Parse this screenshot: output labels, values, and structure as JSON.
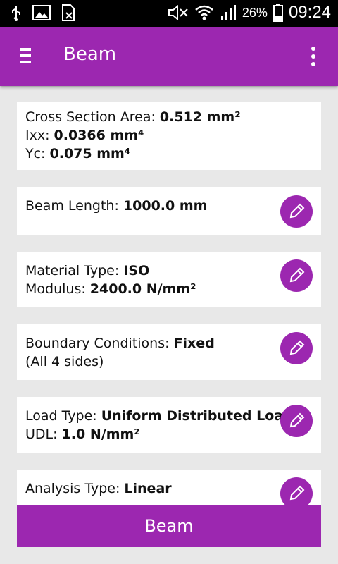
{
  "statusbar": {
    "battery": "26%",
    "time": "09:24"
  },
  "appbar": {
    "title": "Beam"
  },
  "cards": {
    "section": {
      "area_label": "Cross Section Area: ",
      "area_value": "0.512 mm²",
      "ixx_label": "Ixx: ",
      "ixx_value": "0.0366 mm⁴",
      "yc_label": "Yc: ",
      "yc_value": "0.075 mm⁴"
    },
    "length": {
      "label": "Beam Length: ",
      "value": "1000.0 mm"
    },
    "material": {
      "type_label": "Material Type: ",
      "type_value": "ISO",
      "modulus_label": "Modulus: ",
      "modulus_value": "2400.0 N/mm²"
    },
    "boundary": {
      "label": "Boundary Conditions: ",
      "value": "Fixed",
      "note": "(All 4 sides)"
    },
    "load": {
      "type_label": "Load Type: ",
      "type_value": "Uniform Distributed Load",
      "udl_label": "UDL: ",
      "udl_value": "1.0 N/mm²"
    },
    "analysis": {
      "label": "Analysis Type: ",
      "value": "Linear"
    }
  },
  "bottom_button": {
    "label": "Beam"
  },
  "colors": {
    "accent": "#9c27b0",
    "background": "#e8e8e8"
  },
  "icons": [
    "usb-icon",
    "image-icon",
    "sim-icon",
    "mute-icon",
    "wifi-icon",
    "signal-icon",
    "battery-icon",
    "menu-icon",
    "more-vert-icon",
    "pencil-icon"
  ]
}
